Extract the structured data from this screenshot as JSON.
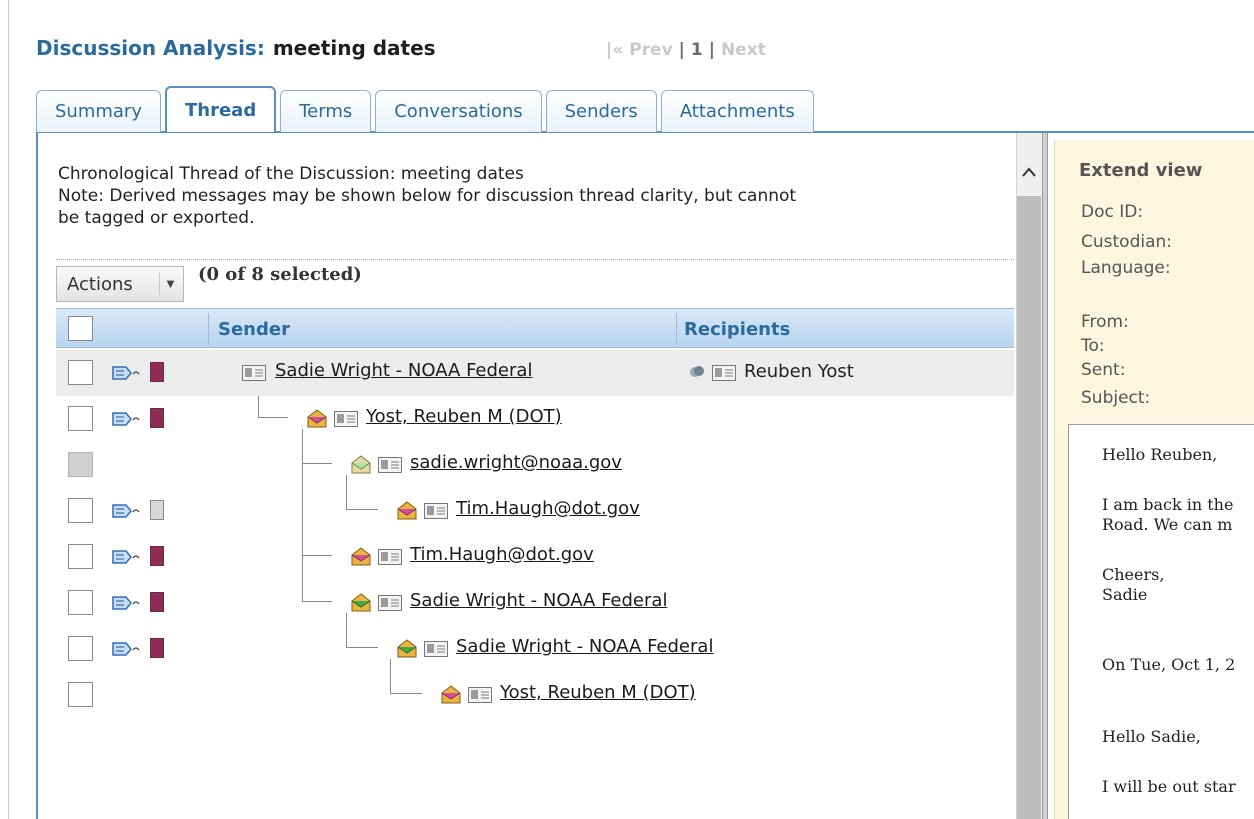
{
  "title": {
    "label": "Discussion Analysis:",
    "value": "meeting dates"
  },
  "pager": {
    "first": "|«",
    "prev": "Prev",
    "sep1": "|",
    "current": "1",
    "sep2": "|",
    "next": "Next"
  },
  "tabs": [
    {
      "label": "Summary",
      "active": false
    },
    {
      "label": "Thread",
      "active": true
    },
    {
      "label": "Terms",
      "active": false
    },
    {
      "label": "Conversations",
      "active": false
    },
    {
      "label": "Senders",
      "active": false
    },
    {
      "label": "Attachments",
      "active": false
    }
  ],
  "thread": {
    "description_line1": "Chronological Thread of the Discussion: meeting dates",
    "description_line2": "Note: Derived messages may be shown below for discussion thread clarity, but cannot",
    "description_line3": "be tagged or exported.",
    "actions_label": "Actions",
    "selected_count": "(0 of 8 selected)",
    "columns": {
      "sender": "Sender",
      "recipients": "Recipients"
    },
    "rows": [
      {
        "sender": "Sadie Wright - NOAA Federal",
        "recipient": "Reuben Yost",
        "tag_color": "#8e2d55"
      },
      {
        "sender": "Yost, Reuben M (DOT)",
        "recipient": "",
        "tag_color": "#8e2d55"
      },
      {
        "sender": "sadie.wright@noaa.gov",
        "recipient": "",
        "tag_color": ""
      },
      {
        "sender": "Tim.Haugh@dot.gov",
        "recipient": "",
        "tag_color": "#d8d8d8"
      },
      {
        "sender": "Tim.Haugh@dot.gov",
        "recipient": "",
        "tag_color": "#8e2d55"
      },
      {
        "sender": "Sadie Wright - NOAA Federal",
        "recipient": "",
        "tag_color": "#8e2d55"
      },
      {
        "sender": "Sadie Wright - NOAA Federal",
        "recipient": "",
        "tag_color": "#8e2d55"
      },
      {
        "sender": "Yost, Reuben M (DOT)",
        "recipient": "",
        "tag_color": ""
      }
    ]
  },
  "extend_view": {
    "title": "Extend view",
    "doc_id": "Doc ID:",
    "custodian": "Custodian:",
    "language": "Language:",
    "from": "From:",
    "to": "To:",
    "sent": "Sent:",
    "subject": "Subject:",
    "preview": {
      "line1": "Hello Reuben,",
      "line2": "I am back in the",
      "line3": "Road. We can m",
      "line4": "Cheers,",
      "line5": "Sadie",
      "line6": "On Tue, Oct 1, 2",
      "line7": "Hello Sadie,",
      "line8": "I will be out star"
    }
  },
  "colors": {
    "accent_blue": "#2a6a9e",
    "tag_maroon": "#8e2d55",
    "extend_bg": "#fdf6de"
  },
  "icons": {
    "message": "message-tag-icon",
    "envelope_open": "open-envelope-icon",
    "envelope_reply": "reply-envelope-icon",
    "envelope_forward": "forward-envelope-icon",
    "contact_card": "contact-card-icon",
    "recipients": "recipient-group-icon"
  }
}
